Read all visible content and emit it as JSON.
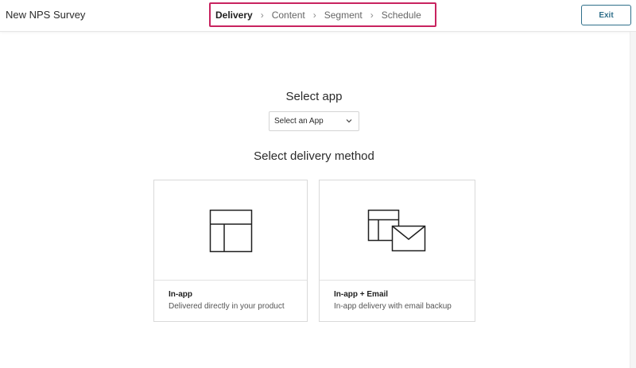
{
  "header": {
    "title": "New NPS Survey",
    "exit_label": "Exit",
    "steps": [
      {
        "label": "Delivery",
        "active": true
      },
      {
        "label": "Content",
        "active": false
      },
      {
        "label": "Segment",
        "active": false
      },
      {
        "label": "Schedule",
        "active": false
      }
    ],
    "step_separator_icon": "chevron-right-icon",
    "highlight_color": "#c8235f",
    "accent_color": "#2f6f8a"
  },
  "app_section": {
    "heading": "Select app",
    "select_value": "Select an App",
    "select_icon": "chevron-down-icon"
  },
  "delivery_section": {
    "heading": "Select delivery method",
    "options": [
      {
        "title": "In-app",
        "description": "Delivered directly in your product",
        "icon": "layout-window-icon"
      },
      {
        "title": "In-app + Email",
        "description": "In-app delivery with email backup",
        "icon": "layout-window-envelope-icon"
      }
    ]
  }
}
